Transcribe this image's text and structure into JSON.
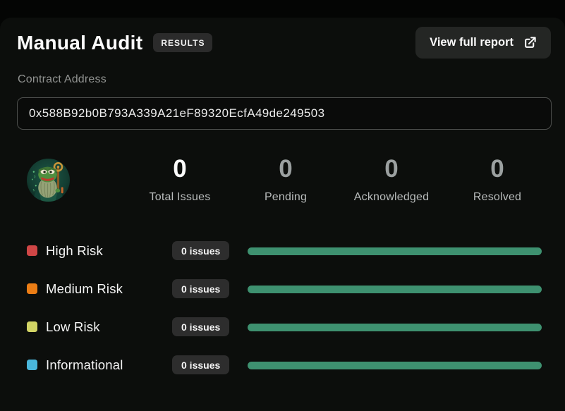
{
  "header": {
    "title": "Manual Audit",
    "results_badge": "RESULTS",
    "view_report_button": "View full report"
  },
  "contract": {
    "label": "Contract Address",
    "address": "0x588B92b0B793A339A21eF89320EcfA49de249503"
  },
  "avatar": {
    "description": "pepe-wizard-token-logo"
  },
  "stats": [
    {
      "value": "0",
      "label": "Total Issues"
    },
    {
      "value": "0",
      "label": "Pending"
    },
    {
      "value": "0",
      "label": "Acknowledged"
    },
    {
      "value": "0",
      "label": "Resolved"
    }
  ],
  "risks": [
    {
      "label": "High Risk",
      "count": "0 issues",
      "swatch_color": "#d04646",
      "bar_percent": 100
    },
    {
      "label": "Medium Risk",
      "count": "0 issues",
      "swatch_color": "#ec7d15",
      "bar_percent": 100
    },
    {
      "label": "Low Risk",
      "count": "0 issues",
      "swatch_color": "#d2d465",
      "bar_percent": 100
    },
    {
      "label": "Informational",
      "count": "0 issues",
      "swatch_color": "#4ab7dc",
      "bar_percent": 100
    }
  ],
  "colors": {
    "progress_bar": "#3e9170",
    "badge_background": "#2d2d2d",
    "card_background": "#0c0e0c"
  }
}
